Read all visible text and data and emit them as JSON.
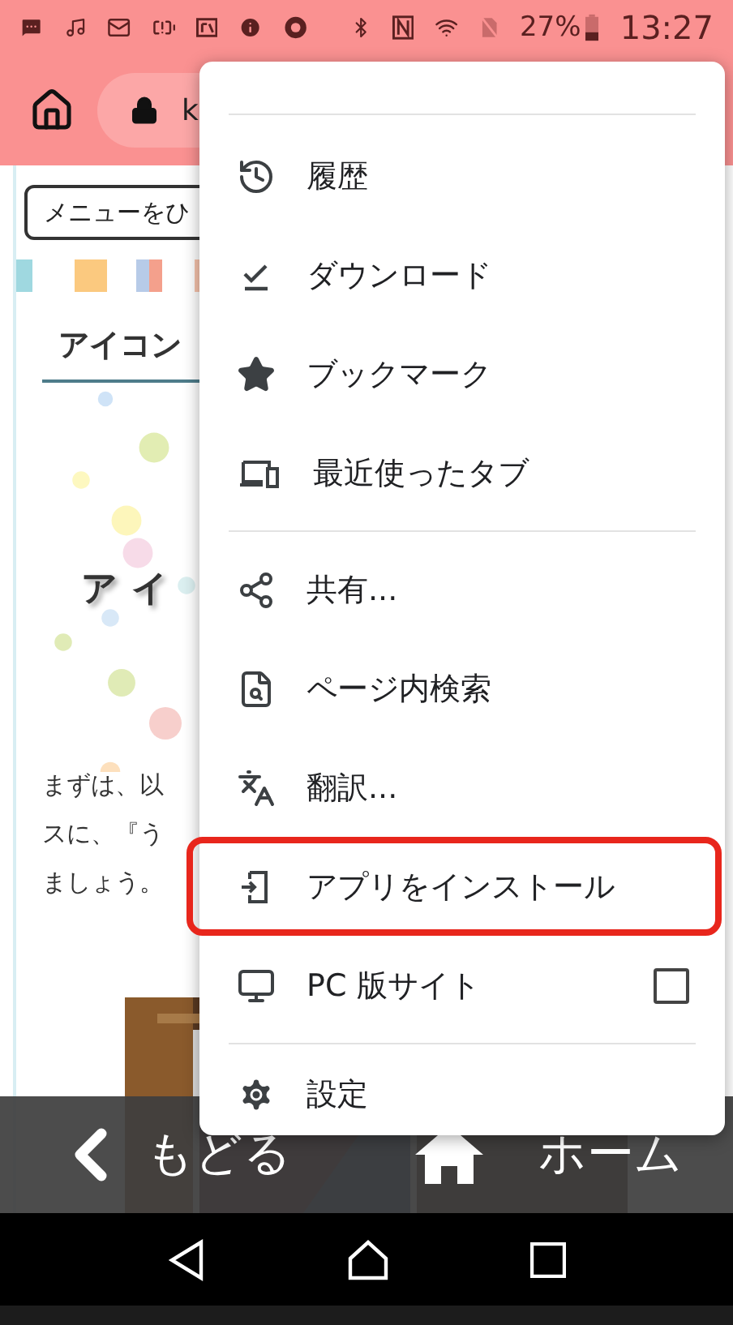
{
  "status_bar": {
    "battery": "27%",
    "time": "13:27"
  },
  "toolbar": {
    "url": "k"
  },
  "page": {
    "menu_button": "メニューをひ",
    "heading": "アイコン",
    "hero_title": "アイ",
    "paragraph": [
      "まずは、以",
      "スに、『う",
      "ましょう。"
    ]
  },
  "menu": {
    "items": [
      {
        "kind": "divider"
      },
      {
        "kind": "item",
        "label": "履歴",
        "highlighted": false
      },
      {
        "kind": "item",
        "label": "ダウンロード",
        "highlighted": false
      },
      {
        "kind": "item",
        "label": "ブックマーク",
        "highlighted": false
      },
      {
        "kind": "item",
        "label": "最近使ったタブ",
        "highlighted": false
      },
      {
        "kind": "divider"
      },
      {
        "kind": "item",
        "label": "共有...",
        "highlighted": false
      },
      {
        "kind": "item",
        "label": "ページ内検索",
        "highlighted": false
      },
      {
        "kind": "item",
        "label": "翻訳...",
        "highlighted": false
      },
      {
        "kind": "item",
        "label": "アプリをインストール",
        "highlighted": true
      },
      {
        "kind": "checkbox",
        "label": "PC 版サイト",
        "checked": false,
        "highlighted": false
      },
      {
        "kind": "divider"
      },
      {
        "kind": "item",
        "label": "設定",
        "highlighted": false
      }
    ]
  },
  "bottom_bar": {
    "back": "もどる",
    "home": "ホーム"
  }
}
